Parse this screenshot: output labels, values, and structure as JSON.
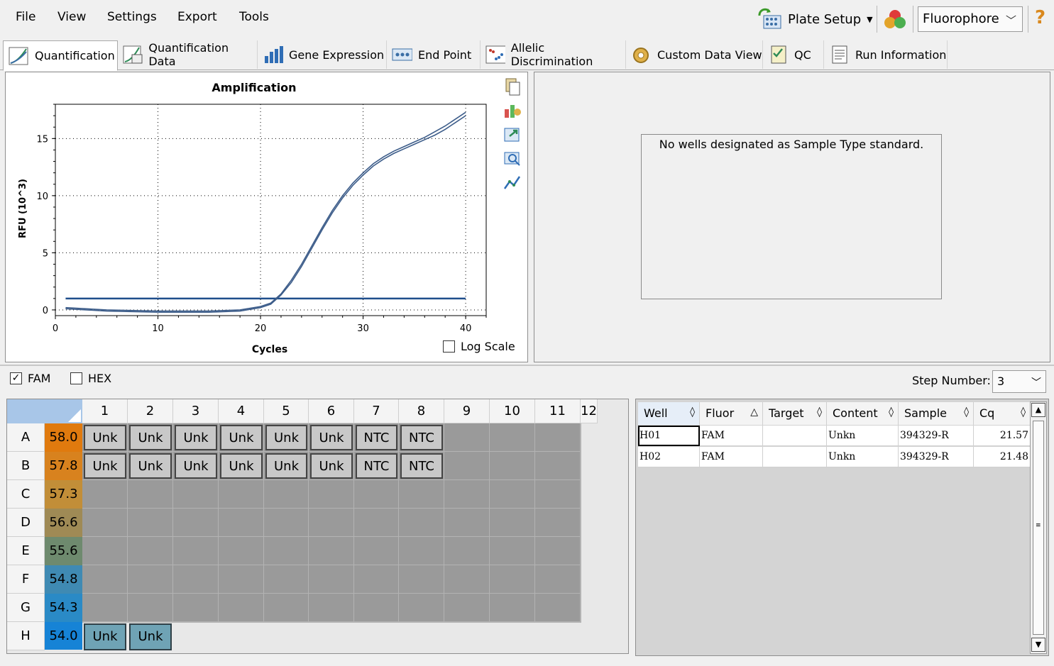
{
  "menu": {
    "file": "File",
    "view": "View",
    "settings": "Settings",
    "export": "Export",
    "tools": "Tools"
  },
  "toolbar": {
    "plate_setup": "Plate Setup",
    "fluorophore": "Fluorophore",
    "help": "?"
  },
  "tabs": [
    "Quantification",
    "Quantification Data",
    "Gene Expression",
    "End Point",
    "Allelic Discrimination",
    "Custom Data View",
    "QC",
    "Run Information"
  ],
  "standard_message": "No wells designated as Sample Type standard.",
  "log_scale_label": "Log Scale",
  "fluors": {
    "fam": "FAM",
    "hex": "HEX"
  },
  "step": {
    "label": "Step Number:",
    "value": "3"
  },
  "plate": {
    "columns": [
      "1",
      "2",
      "3",
      "4",
      "5",
      "6",
      "7",
      "8",
      "9",
      "10",
      "11",
      "12"
    ],
    "rows": [
      "A",
      "B",
      "C",
      "D",
      "E",
      "F",
      "G",
      "H"
    ],
    "temps": [
      "58.0",
      "57.8",
      "57.3",
      "56.6",
      "55.6",
      "54.8",
      "54.3",
      "54.0"
    ],
    "temp_colors": [
      "#e07a0e",
      "#d8821e",
      "#c28e38",
      "#9f8a55",
      "#6e8a6e",
      "#3f8ab3",
      "#2a8ac6",
      "#1683d6"
    ],
    "wells": {
      "A": [
        "Unk",
        "Unk",
        "Unk",
        "Unk",
        "Unk",
        "Unk",
        "NTC",
        "NTC"
      ],
      "B": [
        "Unk",
        "Unk",
        "Unk",
        "Unk",
        "Unk",
        "Unk",
        "NTC",
        "NTC"
      ],
      "H": [
        "Unk",
        "Unk"
      ]
    }
  },
  "table": {
    "headers": [
      "Well",
      "Fluor",
      "Target",
      "Content",
      "Sample",
      "Cq"
    ],
    "rows": [
      [
        "H01",
        "FAM",
        "",
        "Unkn",
        "394329-R",
        "21.57"
      ],
      [
        "H02",
        "FAM",
        "",
        "Unkn",
        "394329-R",
        "21.48"
      ]
    ]
  },
  "chart_data": {
    "type": "line",
    "title": "Amplification",
    "xlabel": "Cycles",
    "ylabel": "RFU (10^3)",
    "xlim": [
      0,
      42
    ],
    "ylim": [
      -0.5,
      18
    ],
    "xticks": [
      0,
      10,
      20,
      30,
      40
    ],
    "yticks": [
      0,
      5,
      10,
      15
    ],
    "grid": true,
    "threshold": 1.0,
    "x": [
      1,
      5,
      10,
      15,
      18,
      20,
      21,
      22,
      23,
      24,
      25,
      26,
      27,
      28,
      29,
      30,
      31,
      32,
      33,
      34,
      35,
      36,
      37,
      38,
      39,
      40
    ],
    "series": [
      {
        "values": [
          0.2,
          0.0,
          -0.1,
          -0.1,
          0.0,
          0.3,
          0.6,
          1.4,
          2.6,
          4.0,
          5.6,
          7.2,
          8.7,
          10.0,
          11.1,
          12.0,
          12.8,
          13.4,
          13.9,
          14.3,
          14.7,
          15.1,
          15.6,
          16.1,
          16.7,
          17.3
        ]
      },
      {
        "values": [
          0.1,
          -0.1,
          -0.2,
          -0.2,
          -0.1,
          0.2,
          0.5,
          1.3,
          2.4,
          3.8,
          5.4,
          7.0,
          8.5,
          9.8,
          10.9,
          11.8,
          12.6,
          13.2,
          13.7,
          14.1,
          14.5,
          14.9,
          15.3,
          15.8,
          16.4,
          17.0
        ]
      }
    ],
    "colors": {
      "curve": "#3d5d8a",
      "threshold": "#1f4e8c"
    }
  }
}
